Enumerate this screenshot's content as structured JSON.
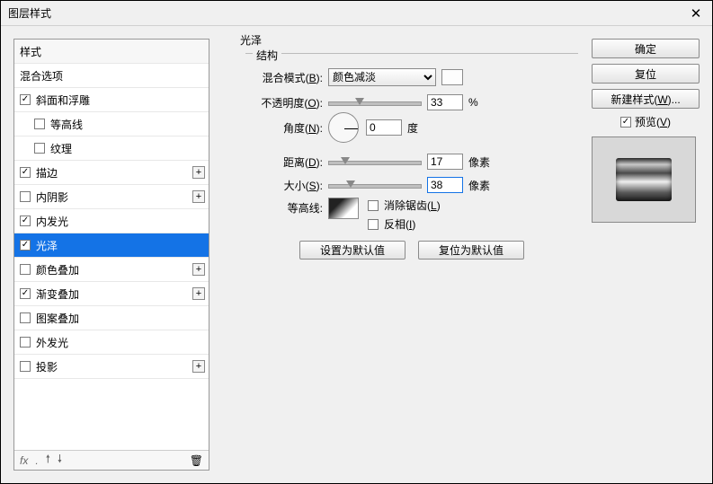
{
  "title": "图层样式",
  "left": {
    "header": "样式",
    "blend": "混合选项",
    "items": [
      {
        "label": "斜面和浮雕",
        "checked": true,
        "plus": false,
        "sub": false
      },
      {
        "label": "等高线",
        "checked": false,
        "plus": false,
        "sub": true
      },
      {
        "label": "纹理",
        "checked": false,
        "plus": false,
        "sub": true
      },
      {
        "label": "描边",
        "checked": true,
        "plus": true,
        "sub": false
      },
      {
        "label": "内阴影",
        "checked": false,
        "plus": true,
        "sub": false
      },
      {
        "label": "内发光",
        "checked": true,
        "plus": false,
        "sub": false
      },
      {
        "label": "光泽",
        "checked": true,
        "plus": false,
        "sub": false,
        "selected": true
      },
      {
        "label": "颜色叠加",
        "checked": false,
        "plus": true,
        "sub": false
      },
      {
        "label": "渐变叠加",
        "checked": true,
        "plus": true,
        "sub": false
      },
      {
        "label": "图案叠加",
        "checked": false,
        "plus": false,
        "sub": false
      },
      {
        "label": "外发光",
        "checked": false,
        "plus": false,
        "sub": false
      },
      {
        "label": "投影",
        "checked": false,
        "plus": true,
        "sub": false
      }
    ],
    "fx": "fx"
  },
  "panel": {
    "group": "光泽",
    "sub": "结构",
    "blendMode": {
      "label": "混合模式(<u>B</u>):",
      "value": "颜色减淡"
    },
    "opacity": {
      "label": "不透明度(<u>O</u>):",
      "value": "33",
      "unit": "%"
    },
    "angle": {
      "label": "角度(<u>N</u>):",
      "value": "0",
      "unit": "度"
    },
    "distance": {
      "label": "距离(<u>D</u>):",
      "value": "17",
      "unit": "像素"
    },
    "size": {
      "label": "大小(<u>S</u>):",
      "value": "38",
      "unit": "像素"
    },
    "contour": {
      "label": "等高线:",
      "anti": "消除锯齿(<u>L</u>)",
      "invert": "反相(<u>I</u>)"
    },
    "defBtn": "设置为默认值",
    "resBtn": "复位为默认值"
  },
  "right": {
    "ok": "确定",
    "cancel": "复位",
    "newStyle": "新建样式(W)...",
    "preview": "预览(V)"
  }
}
